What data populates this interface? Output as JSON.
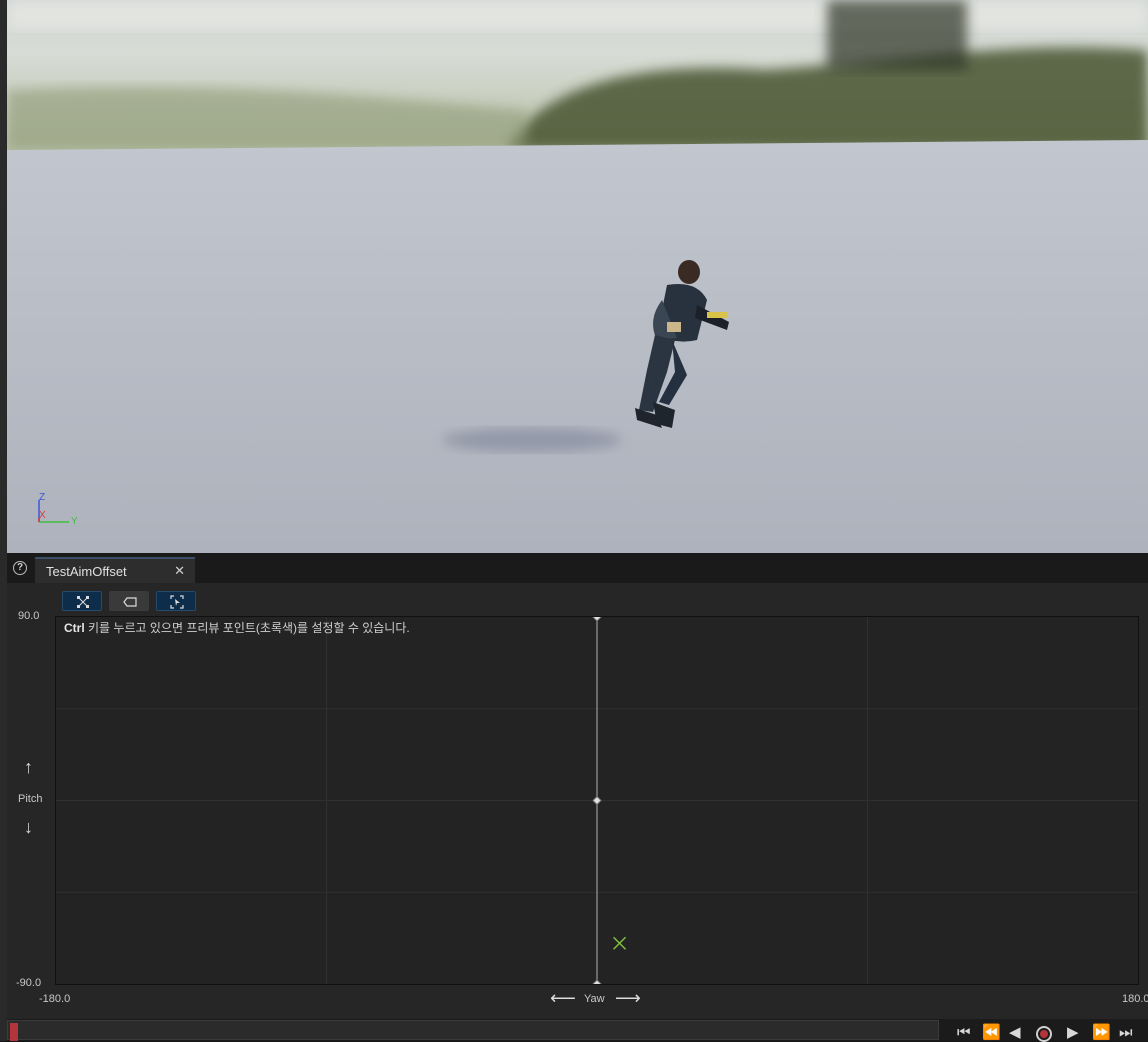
{
  "tab": {
    "title": "TestAimOffset"
  },
  "hint": {
    "key": "Ctrl",
    "text": " 키를 누르고 있으면 프리뷰 포인트(초록색)를 설정할 수 있습니다."
  },
  "axes": {
    "pitch_max": "90.0",
    "pitch_min": "-90.0",
    "yaw_min": "-180.0",
    "yaw_max": "180.0",
    "pitch_label": "Pitch",
    "yaw_label": "Yaw"
  },
  "gizmo": {
    "z": "Z",
    "x": "X",
    "y": "Y"
  },
  "blend_space": {
    "samples": [
      {
        "yaw": 0,
        "pitch": 90
      },
      {
        "yaw": 0,
        "pitch": 0
      },
      {
        "yaw": 0,
        "pitch": -90
      }
    ],
    "preview_point": {
      "yaw": 7.5,
      "pitch": -70
    }
  },
  "colors": {
    "accent": "#7fbf3f",
    "tab_active": "#3c4f66",
    "record": "#b3353a"
  }
}
